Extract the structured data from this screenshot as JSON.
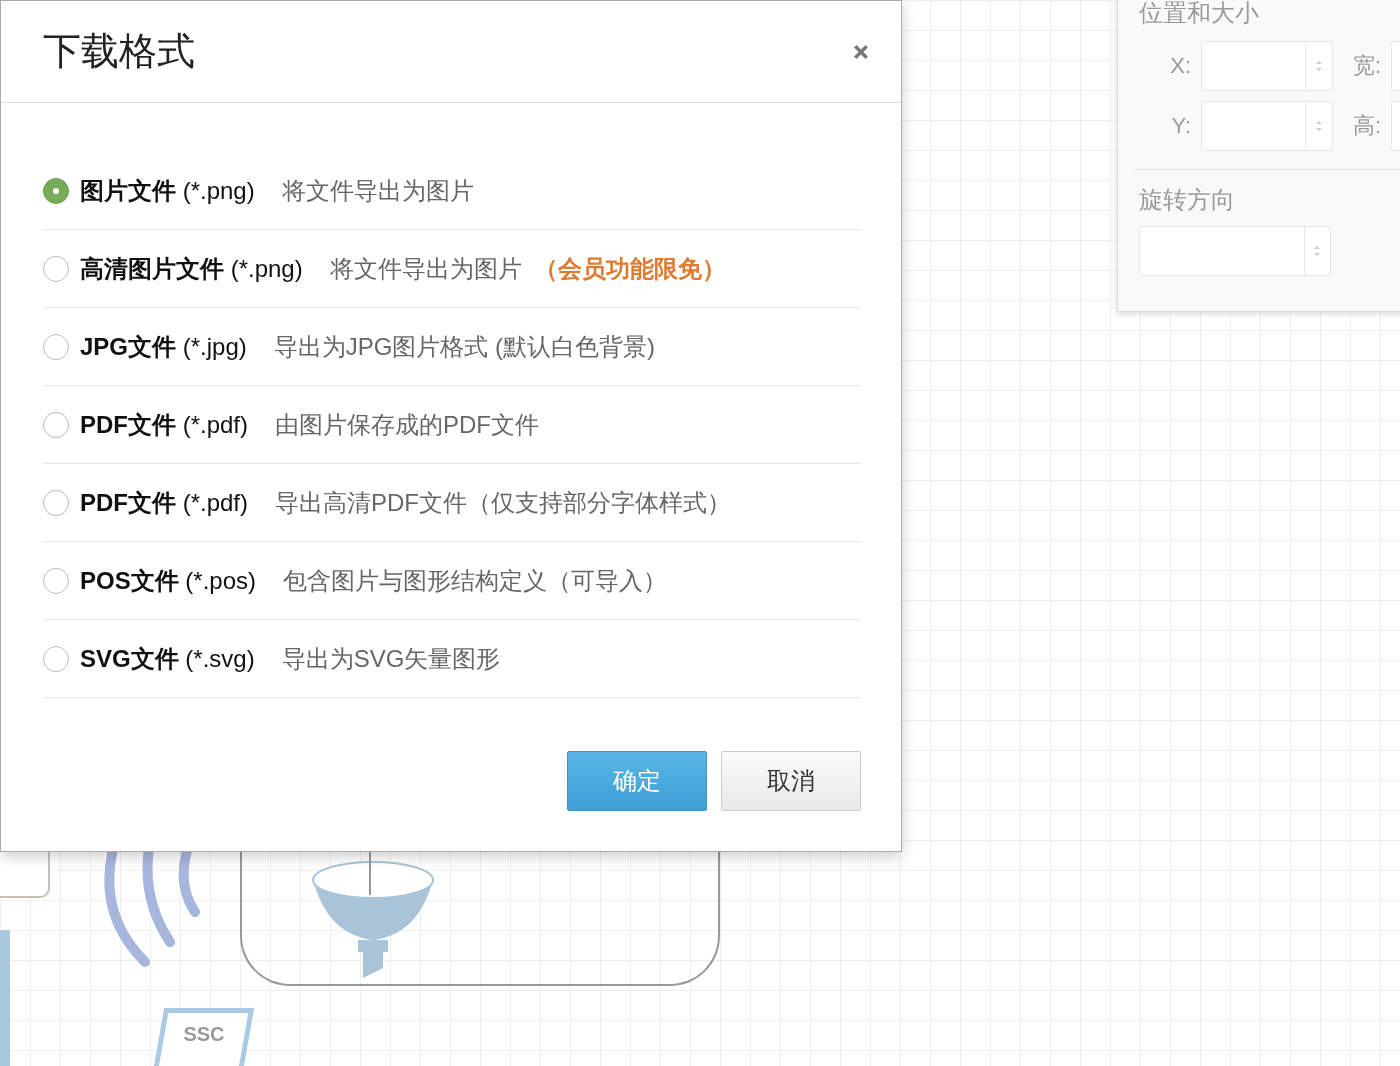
{
  "dialog": {
    "title": "下载格式",
    "options": [
      {
        "name": "**图片文件** (*.png)",
        "description": "将文件导出为图片",
        "selected": true
      },
      {
        "name": "**高清图片文件** (*.png)",
        "description": "将文件导出为图片",
        "note": "（会员功能限免）",
        "selected": false
      },
      {
        "name": "**JPG文件** (*.jpg)",
        "description": "导出为JPG图片格式 (默认白色背景)",
        "selected": false
      },
      {
        "name": "**PDF文件** (*.pdf)",
        "description": "由图片保存成的PDF文件",
        "selected": false
      },
      {
        "name": "**PDF文件** (*.pdf)",
        "description": "导出高清PDF文件（仅支持部分字体样式）",
        "selected": false
      },
      {
        "name": "**POS文件** (*.pos)",
        "description": "包含图片与图形结构定义（可导入）",
        "selected": false
      },
      {
        "name": "**SVG文件** (*.svg)",
        "description": "导出为SVG矢量图形",
        "selected": false
      }
    ],
    "buttons": [
      {
        "label": "确定",
        "kind": "primary"
      },
      {
        "label": "取消",
        "kind": "secondary"
      }
    ]
  },
  "side_panel": {
    "title": "位置和大小",
    "fields": [
      {
        "label": "X:"
      },
      {
        "label": "宽:"
      },
      {
        "label": "Y:"
      },
      {
        "label": "高:"
      }
    ],
    "rotation_title": "旋转方向"
  },
  "canvas": {
    "device_label": "SSC"
  }
}
